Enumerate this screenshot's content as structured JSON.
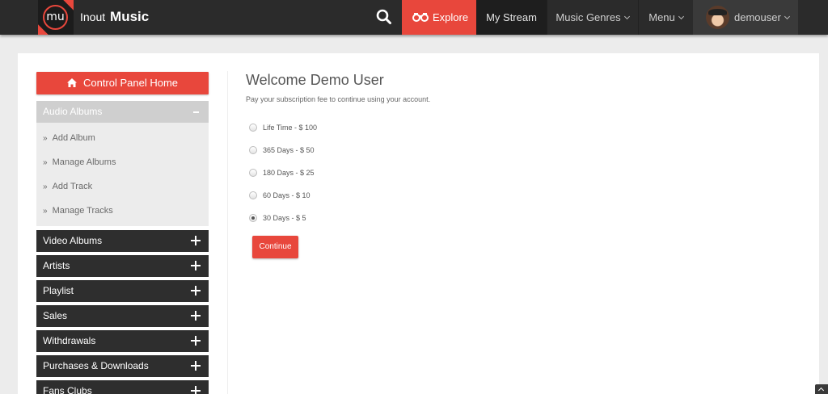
{
  "header": {
    "logo_text": "mu",
    "brand_light": "Inout",
    "brand_bold": "Music",
    "nav": {
      "explore": "Explore",
      "my_stream": "My Stream",
      "music_genres": "Music Genres",
      "menu": "Menu",
      "user": "demouser"
    }
  },
  "sidebar": {
    "home_button": "Control Panel Home",
    "open_section": {
      "title": "Audio Albums",
      "items": [
        "Add Album",
        "Manage Albums",
        "Add Track",
        "Manage Tracks"
      ]
    },
    "sections": [
      "Video Albums",
      "Artists",
      "Playlist",
      "Sales",
      "Withdrawals",
      "Purchases & Downloads",
      "Fans Clubs"
    ]
  },
  "content": {
    "title": "Welcome Demo User",
    "subtitle": "Pay your subscription fee to continue using your account.",
    "plans": [
      {
        "label": "Life Time  -  $ 100",
        "selected": false
      },
      {
        "label": "365 Days  -  $ 50",
        "selected": false
      },
      {
        "label": "180 Days  -  $ 25",
        "selected": false
      },
      {
        "label": "60 Days  -  $ 10",
        "selected": false
      },
      {
        "label": "30 Days  -  $ 5",
        "selected": true
      }
    ],
    "continue_button": "Continue"
  },
  "colors": {
    "accent": "#e8473c",
    "topbar": "#2b2b2b",
    "sidebar_dark": "#2e2e2e"
  }
}
